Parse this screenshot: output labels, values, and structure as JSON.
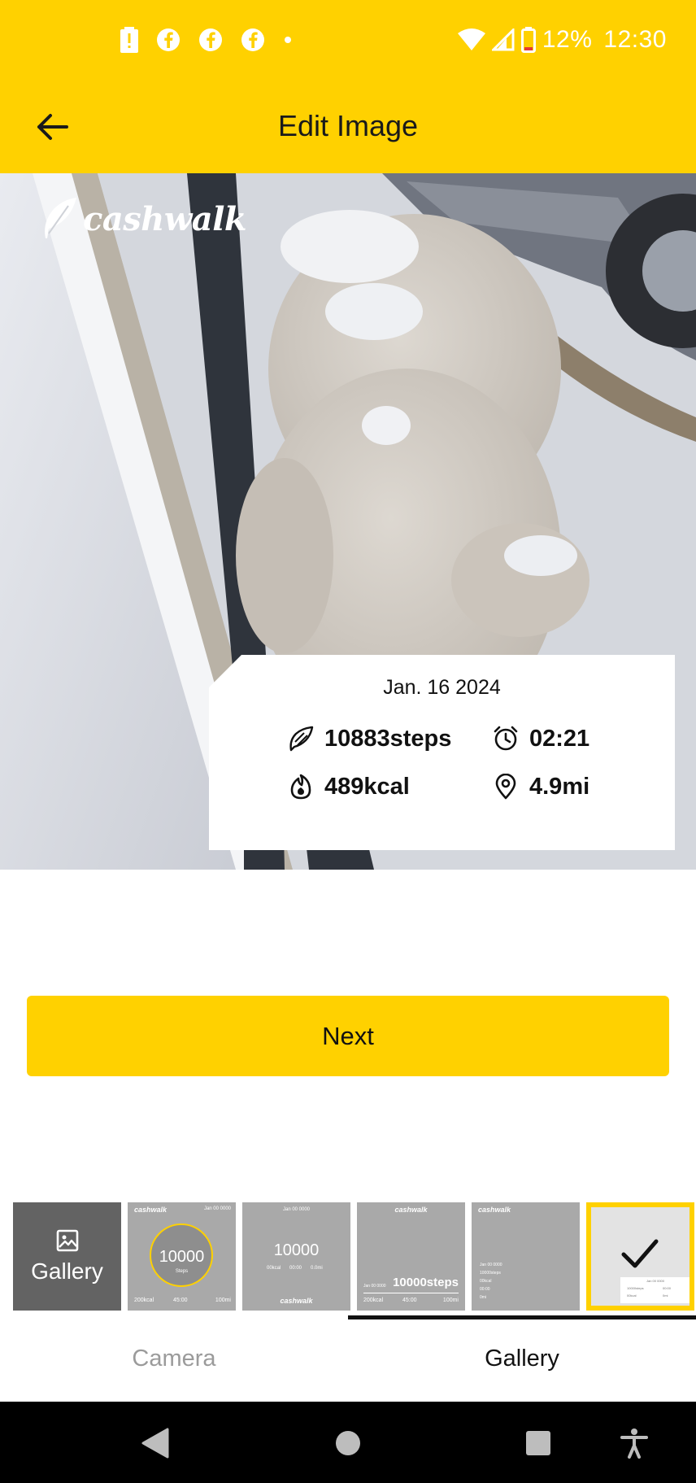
{
  "status_bar": {
    "battery_text": "12%",
    "time": "12:30",
    "left_icons": [
      "battery-alert-icon",
      "facebook-icon",
      "facebook-icon",
      "facebook-icon",
      "dot-icon"
    ],
    "right_icons": [
      "wifi-icon",
      "signal-icon",
      "battery-low-icon"
    ]
  },
  "app_bar": {
    "title": "Edit Image",
    "back_icon": "arrow-left-icon"
  },
  "photo": {
    "logo_text": "cashwalk",
    "stats": {
      "date": "Jan. 16 2024",
      "steps": "10883steps",
      "time": "02:21",
      "calories": "489kcal",
      "distance": "4.9mi"
    }
  },
  "actions": {
    "next_label": "Next"
  },
  "templates": {
    "gallery_label": "Gallery",
    "t1": {
      "logo": "cashwalk",
      "date": "Jan 00 0000",
      "center": "10000",
      "sub": "Steps",
      "kcal": "200kcal",
      "time": "45:00",
      "dist": "100mi"
    },
    "t2": {
      "date": "Jan 00 0000",
      "center": "10000",
      "kcal": "00kcal",
      "time": "00:00",
      "dist": "0.0mi",
      "logo": "cashwalk"
    },
    "t3": {
      "logo": "cashwalk",
      "date": "Jan 00 0000",
      "steps": "10000steps",
      "kcal": "200kcal",
      "time": "45:00",
      "dist": "100mi"
    },
    "t4": {
      "logo": "cashwalk",
      "date": "Jan 00 0000",
      "steps": "10000steps",
      "kcal": "00kcal",
      "time": "00:00",
      "dist": "0mi"
    },
    "t5": {
      "date": "Jan 00 0000",
      "steps": "10000steps",
      "time": "00:00",
      "kcal": "00kcal",
      "dist": "0mi"
    }
  },
  "tabs": {
    "camera": "Camera",
    "gallery": "Gallery",
    "active": "Gallery"
  },
  "colors": {
    "brand_yellow": "#FFD100",
    "tab_inactive": "#9b9b9b"
  }
}
